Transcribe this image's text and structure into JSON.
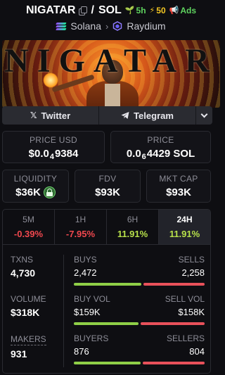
{
  "header": {
    "base_symbol": "NIGATAR",
    "separator": "/",
    "quote_symbol": "SOL",
    "age": "5h",
    "boosts": "50",
    "ads_label": "Ads",
    "chain": "Solana",
    "dex": "Raydium"
  },
  "banner": {
    "title": "NIGATAR"
  },
  "social": {
    "twitter_label": "Twitter",
    "telegram_label": "Telegram"
  },
  "prices": {
    "usd_label": "PRICE USD",
    "usd_prefix": "$0.0",
    "usd_zeros": "4",
    "usd_digits": "9384",
    "native_label": "PRICE",
    "native_prefix": "0.0",
    "native_zeros": "6",
    "native_digits": "4429 SOL"
  },
  "metrics": {
    "liquidity_label": "LIQUIDITY",
    "liquidity_value": "$36K",
    "fdv_label": "FDV",
    "fdv_value": "$93K",
    "mcap_label": "MKT CAP",
    "mcap_value": "$93K"
  },
  "performance": [
    {
      "label": "5M",
      "value": "-0.39%",
      "direction": "down",
      "active": false
    },
    {
      "label": "1H",
      "value": "-7.95%",
      "direction": "down",
      "active": false
    },
    {
      "label": "6H",
      "value": "11.91%",
      "direction": "up",
      "active": false
    },
    {
      "label": "24H",
      "value": "11.91%",
      "direction": "up",
      "active": true
    }
  ],
  "stats": {
    "txns": {
      "label": "TXNS",
      "value": "4,730",
      "left_label": "BUYS",
      "left_value": "2,472",
      "right_label": "SELLS",
      "right_value": "2,258",
      "left_share": 0.523
    },
    "volume": {
      "label": "VOLUME",
      "value": "$318K",
      "left_label": "BUY VOL",
      "left_value": "$159K",
      "right_label": "SELL VOL",
      "right_value": "$158K",
      "left_share": 0.502
    },
    "makers": {
      "label": "MAKERS",
      "value": "931",
      "left_label": "BUYERS",
      "left_value": "876",
      "right_label": "SELLERS",
      "right_value": "804",
      "left_share": 0.521
    }
  },
  "colors": {
    "positive": "#b7e04a",
    "negative": "#f0484e",
    "buy_bar": "#8fcf47",
    "sell_bar": "#e8515a"
  }
}
